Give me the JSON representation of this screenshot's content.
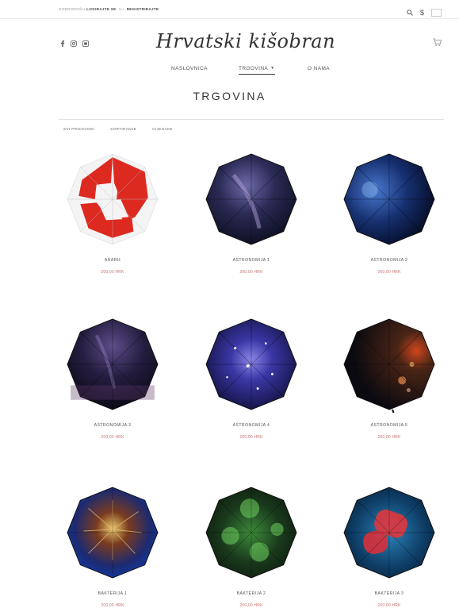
{
  "topbar": {
    "welcome": "DOBRODOŠLI",
    "login": "LOGIRAJTE SE",
    "or": "ILI",
    "register": "REGISTRIRAJTE",
    "currency": "$"
  },
  "brand": {
    "logo_text": "Hrvatski kišobran"
  },
  "nav": {
    "items": [
      {
        "label": "NASLOVNICA"
      },
      {
        "label": "TRGOVINA"
      },
      {
        "label": "O NAMA"
      }
    ]
  },
  "page": {
    "title": "TRGOVINA"
  },
  "filters": [
    "SVI PROIZVODI",
    "SORTIRANJE",
    "CIJENAKE"
  ],
  "products": [
    {
      "name": "ANARH",
      "price": "200,00 HRK"
    },
    {
      "name": "ASTRONOMIJA 1",
      "price": "200,00 HRK"
    },
    {
      "name": "ASTRONOMIJA 2",
      "price": "200,00 HRK"
    },
    {
      "name": "ASTRONOMIJA 3",
      "price": "200,00 HRK"
    },
    {
      "name": "ASTRONOMIJA 4",
      "price": "200,00 HRK"
    },
    {
      "name": "ASTRONOMIJA 5",
      "price": "200,00 HRK"
    },
    {
      "name": "BAKTERIJA 1",
      "price": "200,00 HRK"
    },
    {
      "name": "BAKTERIJA 2",
      "price": "200,00 HRK"
    },
    {
      "name": "BAKTERIJA 3",
      "price": "200,00 HRK"
    }
  ],
  "colors": {
    "price": "#c47070",
    "text": "#333333",
    "muted": "#9a9a9a"
  },
  "icons": [
    "facebook-icon",
    "instagram-icon",
    "youtube-icon",
    "search-icon",
    "cart-icon",
    "croatian-flag-icon"
  ]
}
